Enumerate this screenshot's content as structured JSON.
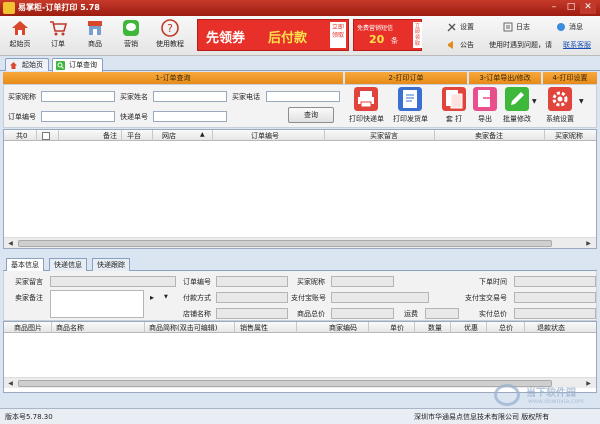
{
  "window": {
    "title": "易掌柜-订单打印 5.78",
    "min": "–",
    "max": "□",
    "close": "✕"
  },
  "toolbar": {
    "items": [
      {
        "label": "起始页",
        "icon": "home-icon"
      },
      {
        "label": "订单",
        "icon": "cart-icon"
      },
      {
        "label": "商品",
        "icon": "store-icon"
      },
      {
        "label": "营销",
        "icon": "chat-icon"
      },
      {
        "label": "使用教程",
        "icon": "help-icon"
      }
    ],
    "banner1": {
      "text1": "先领券",
      "text2": "后付款",
      "side": "立即领取"
    },
    "banner2": {
      "text1": "免费营销短信",
      "num": "20",
      "unit": "条",
      "side": "立即领取"
    },
    "right": {
      "settings": "设置",
      "log": "日志",
      "message": "消息",
      "notice": "公告",
      "notice_text": "使用时遇到问题，请",
      "contact": "联系客服"
    }
  },
  "tabs": {
    "start": "起始页",
    "order_query": "订单查询"
  },
  "sections": {
    "s1": "1-订单查询",
    "s2": "2-打印订单",
    "s3": "3-订单导出/修改",
    "s4": "4-打印设置"
  },
  "query": {
    "buyer_nick": "买家昵称",
    "buyer_name": "买家姓名",
    "buyer_phone": "买家电话",
    "order_no": "订单编号",
    "express_no": "快递单号",
    "query_button": "查询"
  },
  "actions": {
    "print_express": "打印快递单",
    "print_invoice": "打印发货单",
    "print_both": "套 打",
    "export": "导出",
    "batch_edit": "批量修改",
    "system_settings": "系统设置"
  },
  "grid1": {
    "count": "共0",
    "columns": [
      "备注",
      "平台",
      "网店",
      "订单编号",
      "买家留言",
      "卖家备注",
      "买家昵称"
    ]
  },
  "detail": {
    "tabs": [
      "基本信息",
      "快递信息",
      "快递跟踪"
    ],
    "fields": {
      "buyer_msg": "买家留言",
      "seller_note": "卖家备注",
      "order_no": "订单编号",
      "pay_method": "付款方式",
      "shop_name": "店铺名称",
      "buyer_nick": "买家昵称",
      "alipay_account": "支付宝账号",
      "goods_total": "商品总价",
      "shipping": "运费",
      "order_time": "下单时间",
      "alipay_trade": "支付宝交易号",
      "actual_total": "实付总价",
      "flag": "▸"
    }
  },
  "grid2": {
    "columns": [
      "商品图片",
      "商品名称",
      "商品简称(双击可编辑)",
      "销售属性",
      "商家编码",
      "单价",
      "数量",
      "优惠",
      "总价",
      "退款状态"
    ]
  },
  "status": {
    "version": "版本号5.78.30",
    "copyright": "深圳市华通易点信息技术有限公司 版权所有"
  },
  "watermark": {
    "text": "当下软件园",
    "url": "www.downxia.com"
  },
  "colors": {
    "titlebar": "#b52a1c",
    "section": "#ef9a2a",
    "banner": "#e63029"
  }
}
